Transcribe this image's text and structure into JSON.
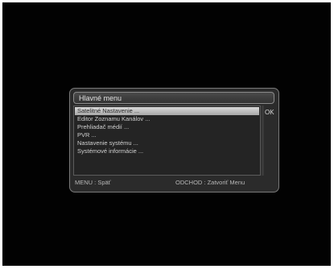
{
  "menu": {
    "title": "Hlavné menu",
    "items": [
      "Satelitné Nastavenie ...",
      "Editor Zoznamu Kanálov ...",
      "Prehliadač médií ...",
      "PVR ...",
      "Nastavenie systému ...",
      "Systémové informácie ..."
    ],
    "selected_index": 0,
    "ok_label": "OK"
  },
  "footer": {
    "left_hint": "MENU   : Späť",
    "right_hint": "ODCHOD : Zatvoriť Menu"
  },
  "colors": {
    "screen_bg": "#020202",
    "window_bg": "#2b2b2b",
    "selection": "#c8c8c8",
    "text": "#cfcfcf"
  }
}
